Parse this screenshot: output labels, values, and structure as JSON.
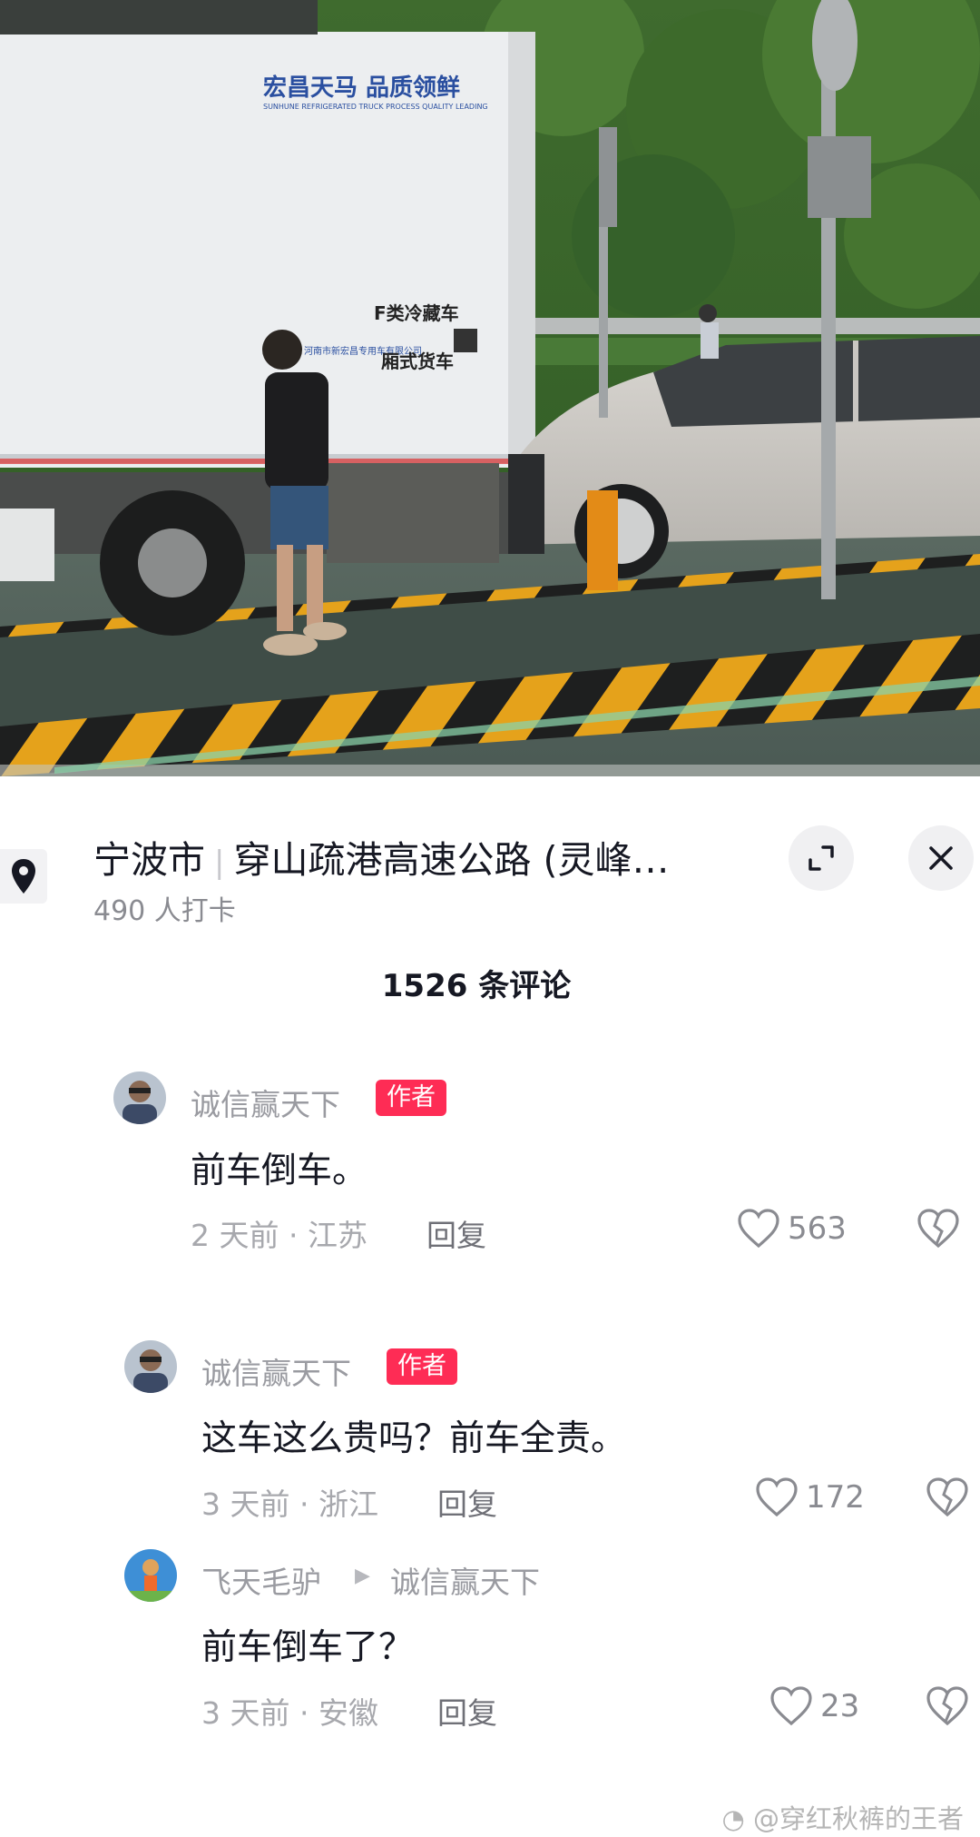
{
  "photo": {
    "truck_brand": "宏昌天马 品质领鲜",
    "truck_brand_en": "SUNHUNE REFRIGERATED TRUCK  PROCESS QUALITY LEADING",
    "truck_type_1": "F类冷藏车",
    "truck_type_2": "厢式货车",
    "truck_maker": "河南市新宏昌专用车有限公司"
  },
  "location": {
    "city": "宁波市",
    "place": "穿山疏港高速公路 (灵峰…",
    "checkins": "490 人打卡"
  },
  "comments_count": "1526 条评论",
  "comments": [
    {
      "user": "诚信赢天下",
      "badge": "作者",
      "text": "前车倒车。",
      "time_loc": "2 天前 · 江苏",
      "reply": "回复",
      "likes": "563"
    },
    {
      "user": "诚信赢天下",
      "badge": "作者",
      "text": "这车这么贵吗？前车全责。",
      "time_loc": "3 天前 · 浙江",
      "reply": "回复",
      "likes": "172"
    },
    {
      "user": "飞天毛驴",
      "reply_to": "诚信赢天下",
      "text": "前车倒车了？",
      "time_loc": "3 天前 · 安徽",
      "reply": "回复",
      "likes": "23"
    }
  ],
  "watermark": "@穿红秋裤的王者",
  "icons": {
    "pin": "location-pin-icon",
    "expand": "expand-icon",
    "close": "close-icon",
    "like": "heart-icon",
    "dislike": "broken-heart-icon"
  },
  "colors": {
    "badge": "#fe2c55",
    "text": "#161823",
    "muted": "#a7a8ad"
  }
}
